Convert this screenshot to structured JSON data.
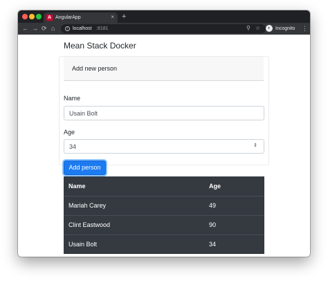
{
  "browser": {
    "tab_title": "AngularApp",
    "tab_favicon": "angular-logo-icon",
    "tab_close": "×",
    "new_tab": "+",
    "url_host": "localhost",
    "url_port": ":8181",
    "profile_label": "Incognito",
    "nav": {
      "back": "←",
      "forward": "→",
      "reload": "⟳",
      "home": "⌂"
    },
    "icons": {
      "info": "i",
      "zoom": "⚲",
      "star": "☆",
      "menu": "⋮",
      "incognito": "◐"
    },
    "colors": {
      "frame": "#202124",
      "toolbar": "#35363a",
      "angular": "#dd0031"
    }
  },
  "page": {
    "title": "Mean Stack Docker",
    "form": {
      "header": "Add new person",
      "name_label": "Name",
      "name_value": "Usain Bolt",
      "age_label": "Age",
      "age_value": "34",
      "submit_label": "Add person",
      "spinner_icon": "⇕"
    },
    "table": {
      "headers": [
        "Name",
        "Age"
      ],
      "rows": [
        [
          "Mariah Carey",
          "49"
        ],
        [
          "Clint Eastwood",
          "90"
        ],
        [
          "Usain Bolt",
          "34"
        ]
      ]
    },
    "colors": {
      "primary": "#1d7bf0",
      "table_dark": "#343a40"
    }
  }
}
